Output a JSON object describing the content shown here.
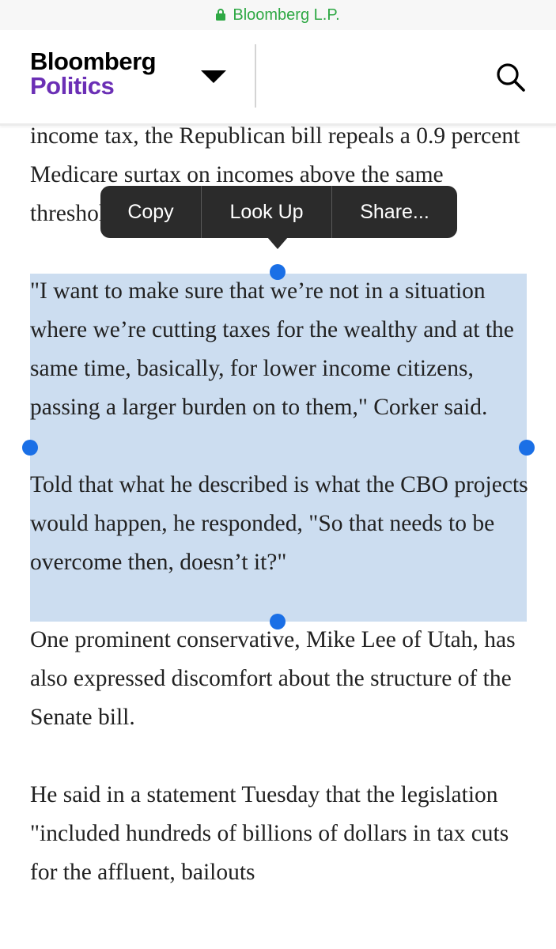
{
  "browser": {
    "url_label": "Bloomberg L.P.",
    "lock_icon": "lock-icon",
    "accent_color": "#2ea844"
  },
  "header": {
    "logo_line1": "Bloomberg",
    "logo_line2": "Politics",
    "logo_line2_color": "#6b2fb5",
    "menu_icon": "caret-down-icon",
    "search_icon": "search-icon"
  },
  "context_menu": {
    "items": [
      "Copy",
      "Look Up",
      "Share..."
    ]
  },
  "article": {
    "paragraphs": [
      "income tax, the Republican bill repeals a 0.9 percent Medicare surtax on incomes above the same threshold.",
      "\"I want to make sure that we’re not in a situation where we’re cutting taxes for the wealthy and at the same time, basically, for lower income citizens, passing a larger burden on to them,\" Corker said.",
      "Told that what he described is what the CBO projects would happen, he responded, \"So that needs to be overcome then, doesn’t it?\"",
      "One prominent conservative, Mike Lee of Utah, has also expressed discomfort about the structure of the Senate bill.",
      "He said in a statement Tuesday that the legislation \"included hundreds of billions of dollars in tax cuts for the affluent, bailouts"
    ],
    "selection_color": "#c6d9ee",
    "handle_color": "#1a6fe6"
  }
}
